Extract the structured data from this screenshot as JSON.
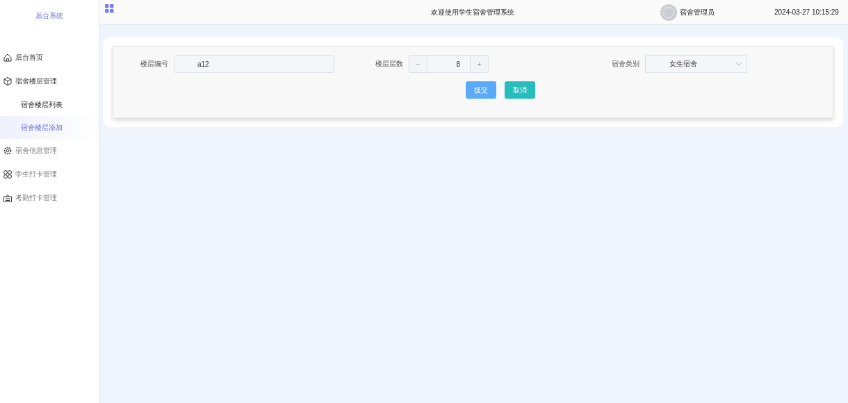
{
  "sidebar": {
    "brand": "后台系统",
    "items": [
      {
        "label": "后台首页",
        "kind": "item",
        "selected": false
      },
      {
        "label": "宿舍楼层管理",
        "kind": "group",
        "expanded": true,
        "children": [
          {
            "label": "宿舍楼层列表",
            "selected": false
          },
          {
            "label": "宿舍楼层添加",
            "selected": true
          }
        ]
      },
      {
        "label": "宿舍信息管理",
        "kind": "group",
        "expanded": false
      },
      {
        "label": "学生打卡管理",
        "kind": "group",
        "expanded": false
      },
      {
        "label": "考勤打卡管理",
        "kind": "group",
        "expanded": false
      }
    ]
  },
  "header": {
    "title": "欢迎使用学生宿舍管理系统",
    "user": "宿舍管理员",
    "datetime": "2024-03-27 10:15:29"
  },
  "form": {
    "fields": [
      {
        "kind": "text",
        "label": "楼层编号",
        "value": "a12"
      },
      {
        "kind": "number",
        "label": "楼层层数",
        "value": "8",
        "minus": "−",
        "plus": "+"
      },
      {
        "kind": "select",
        "label": "宿舍类别",
        "value": "女生宿舍"
      }
    ],
    "buttons": [
      {
        "label": "提交",
        "kind": "primary"
      },
      {
        "label": "取消",
        "kind": "cancel"
      }
    ]
  }
}
